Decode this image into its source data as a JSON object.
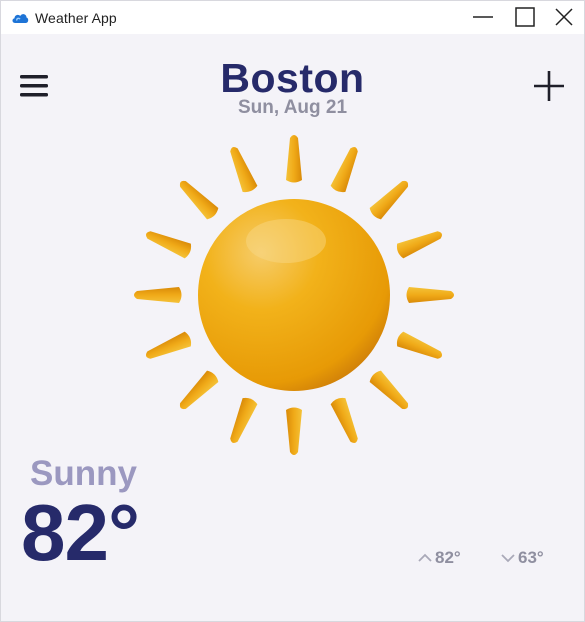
{
  "window": {
    "title": "Weather App",
    "controls": [
      "minimize",
      "maximize",
      "close"
    ]
  },
  "header": {
    "city": "Boston",
    "date": "Sun, Aug 21"
  },
  "current": {
    "condition": "Sunny",
    "condition_icon": "sun-icon",
    "temperature": "82°",
    "high": "82°",
    "low": "63°"
  },
  "icons": {
    "menu": "hamburger-menu-icon",
    "add": "plus-icon",
    "app": "cloud-app-icon"
  },
  "colors": {
    "accent_dark": "#262a6a",
    "condition_text": "#9b98c0",
    "muted_text": "#8f8fa0",
    "background": "#f4f3f8",
    "sun": "#f2b21a"
  }
}
